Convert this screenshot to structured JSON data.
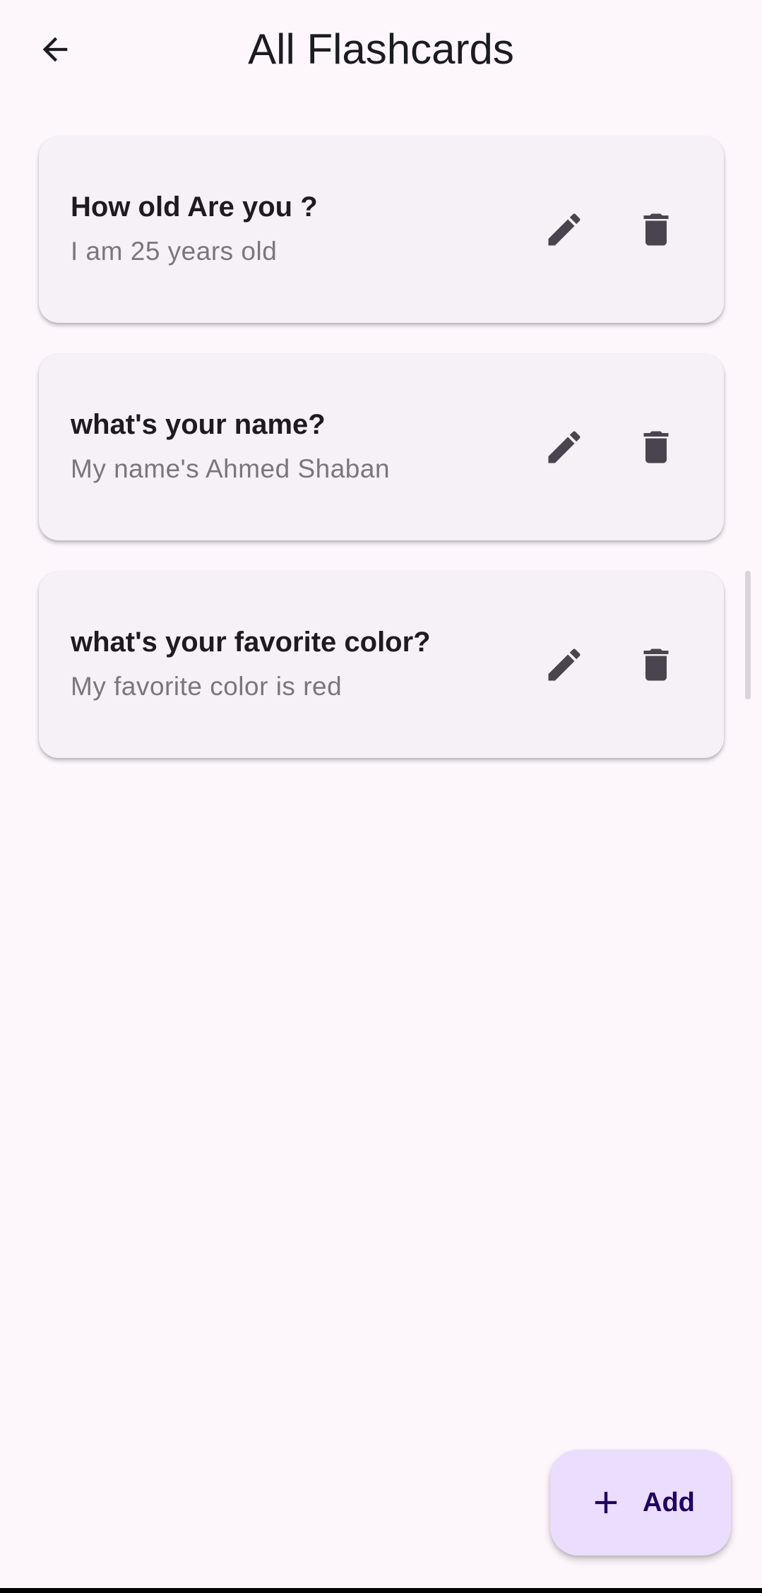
{
  "app_bar": {
    "title": "All Flashcards",
    "back_icon": "arrow-back-icon"
  },
  "cards": [
    {
      "question": "How old Are you ?",
      "answer": "I am 25 years old"
    },
    {
      "question": "what's your name?",
      "answer": "My name's Ahmed Shaban"
    },
    {
      "question": "what's your favorite color?",
      "answer": "My favorite color is red"
    }
  ],
  "card_icons": {
    "edit": "pencil-icon",
    "delete": "trash-icon"
  },
  "fab": {
    "label": "Add",
    "icon": "plus-icon"
  },
  "colors": {
    "background": "#fdf7fc",
    "card": "#f6f1f7",
    "fab": "#eaddfd",
    "icon": "#49454f"
  }
}
